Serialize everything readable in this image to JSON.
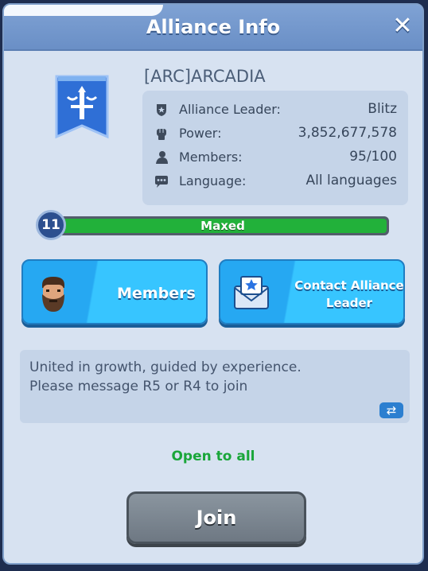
{
  "header": {
    "title": "Alliance Info",
    "close_icon": "close-icon"
  },
  "alliance": {
    "name": "[ARC]ARCADIA",
    "emblem_icon": "banner-sword-emblem-icon",
    "stats": [
      {
        "icon": "shield-icon",
        "label": "Alliance Leader:",
        "value": "Blitz"
      },
      {
        "icon": "fist-icon",
        "label": "Power:",
        "value": "3,852,677,578"
      },
      {
        "icon": "person-icon",
        "label": "Members:",
        "value": "95/100"
      },
      {
        "icon": "chat-icon",
        "label": "Language:",
        "value": "All languages"
      }
    ],
    "level": "11",
    "level_text": "Maxed",
    "level_progress": 1.0
  },
  "buttons": {
    "members": "Members",
    "contact_line1": "Contact Alliance",
    "contact_line2": "Leader",
    "join": "Join"
  },
  "description": {
    "line1": "United in growth, guided by experience.",
    "line2": "Please message R5 or R4 to join",
    "translate_icon": "translate-icon"
  },
  "status": "Open to all",
  "colors": {
    "panel": "#d7e2f1",
    "title_bar": "#6a8fc6",
    "green": "#22b13a",
    "blue_button": "#26a8f2"
  }
}
